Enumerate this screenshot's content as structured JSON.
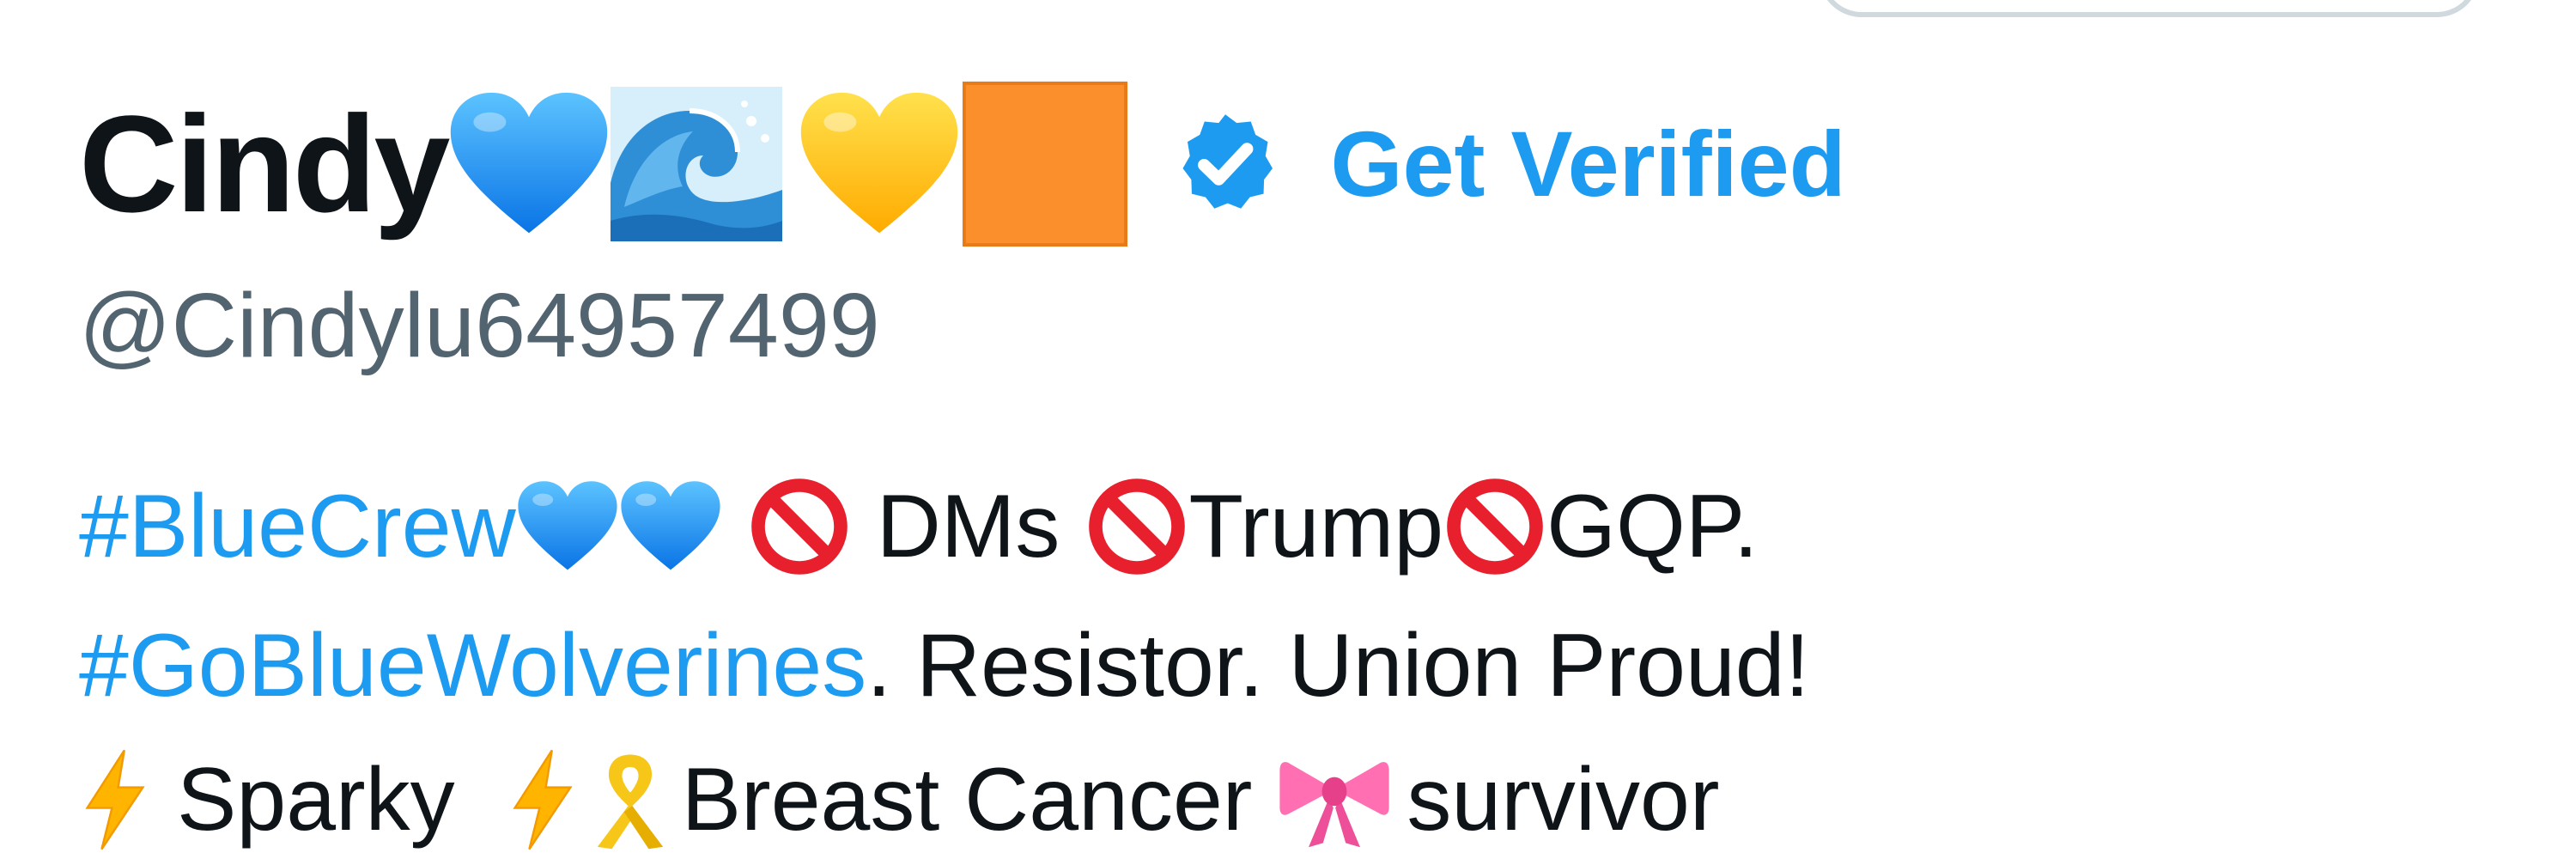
{
  "profile": {
    "display_name": "Cindy",
    "name_emojis": [
      "blue-heart-icon",
      "water-wave-icon",
      "yellow-heart-icon",
      "orange-square-icon"
    ],
    "verified_badge": "verified-badge-icon",
    "get_verified_label": "Get Verified",
    "handle": "@Cindylu64957499"
  },
  "bio": {
    "line1": {
      "hashtag": "#BlueCrew",
      "dms": "DMs",
      "trump": "Trump",
      "gqp": "GQP."
    },
    "line2": {
      "hashtag": "#GoBlueWolverines",
      "rest": ". Resistor. Union Proud!"
    },
    "line3": {
      "sparky": "Sparky",
      "breast_cancer": "Breast Cancer",
      "survivor": "survivor"
    }
  },
  "colors": {
    "accent": "#1d9bf0",
    "text_primary": "#0f1419",
    "text_secondary": "#536471"
  }
}
